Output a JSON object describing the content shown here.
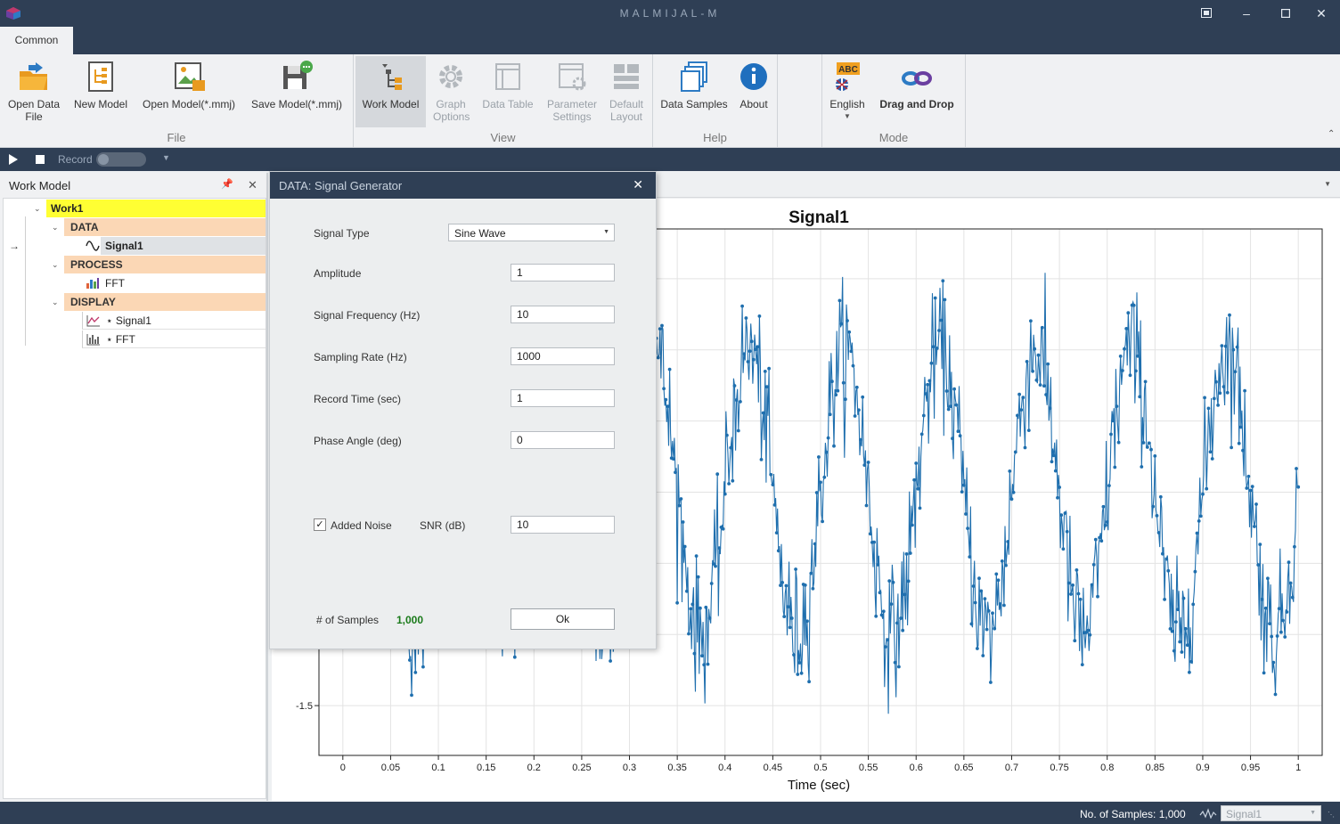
{
  "window": {
    "title": "MALMIJAL-M"
  },
  "tabs": [
    {
      "label": "Common"
    }
  ],
  "ribbon": {
    "file": {
      "label": "File",
      "buttons": [
        "Open Data File",
        "New Model",
        "Open Model(*.mmj)",
        "Save Model(*.mmj)"
      ]
    },
    "view": {
      "label": "View",
      "buttons": [
        "Work Model",
        "Graph Options",
        "Data Table",
        "Parameter Settings",
        "Default Layout"
      ]
    },
    "help": {
      "label": "Help",
      "buttons": [
        "Data Samples",
        "About"
      ]
    },
    "mode": {
      "label": "Mode",
      "buttons": [
        "English",
        "Drag and Drop"
      ]
    }
  },
  "toolbar": {
    "record_label": "Record"
  },
  "work_model": {
    "title": "Work Model",
    "tree": {
      "root": "Work1",
      "data_header": "DATA",
      "data_items": [
        "Signal1"
      ],
      "process_header": "PROCESS",
      "process_items": [
        "FFT"
      ],
      "display_header": "DISPLAY",
      "display_items": [
        "⋆ Signal1",
        "⋆ FFT"
      ]
    }
  },
  "dialog": {
    "title": "DATA: Signal Generator",
    "signal_type_label": "Signal Type",
    "signal_type_value": "Sine Wave",
    "amplitude_label": "Amplitude",
    "amplitude_value": "1",
    "frequency_label": "Signal Frequency (Hz)",
    "frequency_value": "10",
    "sampling_label": "Sampling Rate (Hz)",
    "sampling_value": "1000",
    "record_time_label": "Record Time (sec)",
    "record_time_value": "1",
    "phase_label": "Phase Angle (deg)",
    "phase_value": "0",
    "noise_label": "Added Noise",
    "noise_checked": true,
    "snr_label": "SNR (dB)",
    "snr_value": "10",
    "samples_label": "# of Samples",
    "samples_value": "1,000",
    "ok_label": "Ok"
  },
  "status": {
    "samples_text": "No. of Samples: 1,000",
    "selected_signal": "Signal1"
  },
  "colors": {
    "dark": "#2f3f55",
    "accent": "#f0a020",
    "series": "#1f6fae",
    "samples": "#1a7a1a",
    "root_highlight": "#ffff33",
    "category_highlight": "#fbd7b5"
  },
  "chart_data": {
    "type": "line",
    "title": "Signal1",
    "xlabel": "Time (sec)",
    "ylabel": "",
    "xlim": [
      -0.025,
      1.025
    ],
    "x_ticks": [
      "0",
      "0.05",
      "0.1",
      "0.15",
      "0.2",
      "0.25",
      "0.3",
      "0.35",
      "0.4",
      "0.45",
      "0.5",
      "0.55",
      "0.6",
      "0.65",
      "0.7",
      "0.75",
      "0.8",
      "0.85",
      "0.9",
      "0.95",
      "1"
    ],
    "y_ticks": [
      "-1.5"
    ],
    "ylim": [
      -1.85,
      1.85
    ],
    "grid": true,
    "series": [
      {
        "frequency_hz": 10,
        "amplitude": 1,
        "sample_rate_hz": 1000,
        "record_time_sec": 1,
        "snr_db": 10
      }
    ]
  }
}
